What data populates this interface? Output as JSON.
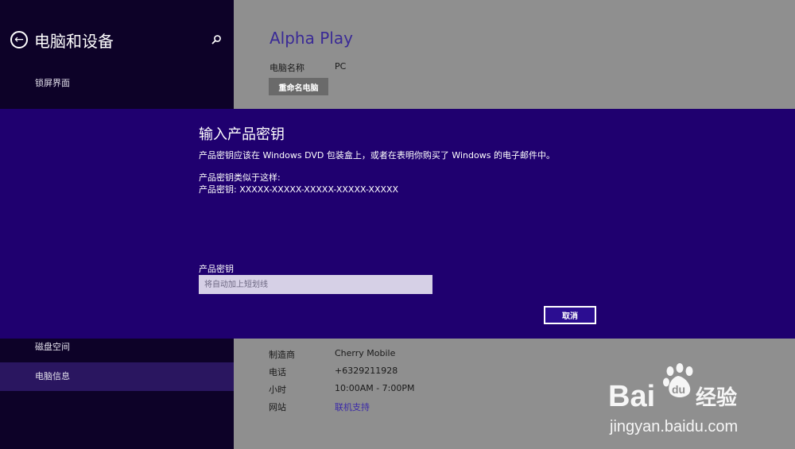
{
  "nav": {
    "title": "电脑和设备",
    "items": [
      {
        "label": "锁屏界面",
        "selected": false
      },
      {
        "label": "磁盘空间",
        "selected": false
      },
      {
        "label": "电脑信息",
        "selected": true
      }
    ]
  },
  "content": {
    "title": "Alpha Play",
    "pc_name_label": "电脑名称",
    "pc_name_value": "PC",
    "rename_button": "重命名电脑",
    "support": [
      {
        "label": "制造商",
        "value": "Cherry Mobile"
      },
      {
        "label": "电话",
        "value": "+6329211928"
      },
      {
        "label": "小时",
        "value": "10:00AM - 7:00PM"
      },
      {
        "label": "网站",
        "value": "联机支持"
      }
    ]
  },
  "dialog": {
    "title": "输入产品密钥",
    "description": "产品密钥应该在 Windows DVD 包装盒上，或者在表明你购买了 Windows 的电子邮件中。",
    "example_line1": "产品密钥类似于这样:",
    "example_line2": "产品密钥: XXXXX-XXXXX-XXXXX-XXXXX-XXXXX",
    "field_label": "产品密钥",
    "input_placeholder": "将自动加上短划线",
    "input_value": "",
    "cancel_button": "取消"
  },
  "watermark": {
    "brand": "Bai du 经验",
    "url": "jingyan.baidu.com"
  },
  "colors": {
    "dialog_bg": "#1f006f",
    "nav_bg": "#0d0228",
    "content_bg": "#8f8f8f",
    "accent": "#3a2a96"
  }
}
